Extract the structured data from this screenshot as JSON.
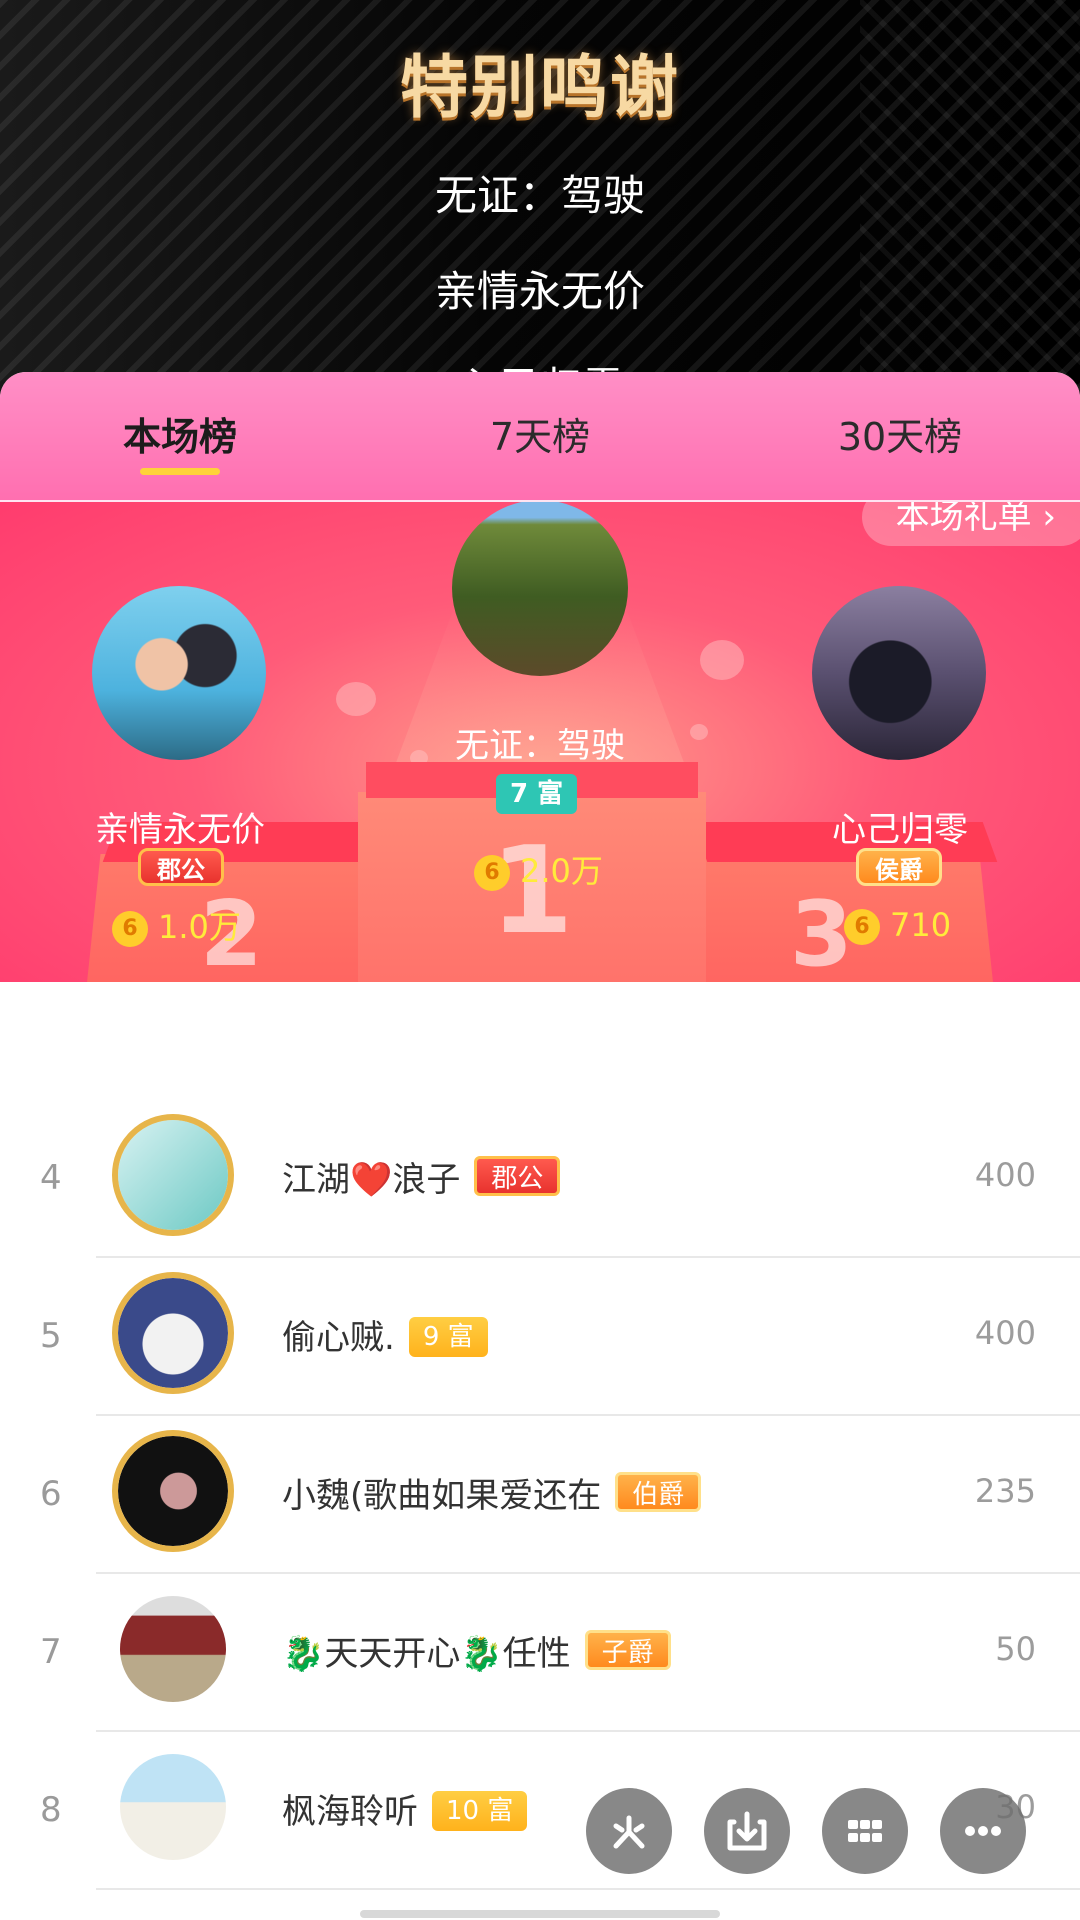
{
  "credits": {
    "title": "特别鸣谢",
    "lines": [
      "无证：驾驶",
      "亲情永无价",
      "心己归零"
    ]
  },
  "tabs": [
    {
      "label": "本场榜",
      "active": true
    },
    {
      "label": "7天榜",
      "active": false
    },
    {
      "label": "30天榜",
      "active": false
    }
  ],
  "gift_link": "本场礼单 ›",
  "podium": {
    "first": {
      "name": "无证：驾驶",
      "badge": "7 富",
      "score": "2.0万",
      "place": "1"
    },
    "second": {
      "name": "亲情永无价",
      "badge": "郡公",
      "score": "1.0万",
      "place": "2"
    },
    "third": {
      "name": "心己归零",
      "badge": "侯爵",
      "score": "710",
      "place": "3"
    }
  },
  "coin_symbol": "6",
  "list": [
    {
      "rank": "4",
      "name": "江湖❤️浪子",
      "tag": "郡公",
      "tag_style": "red",
      "score": "400"
    },
    {
      "rank": "5",
      "name": "偷心贼.",
      "tag": "9 富",
      "tag_style": "gold",
      "score": "400"
    },
    {
      "rank": "6",
      "name": "小魏(歌曲如果爱还在",
      "tag": "伯爵",
      "tag_style": "orange",
      "score": "235"
    },
    {
      "rank": "7",
      "name": "🐉天天开心🐉任性",
      "tag": "子爵",
      "tag_style": "orange",
      "score": "50"
    },
    {
      "rank": "8",
      "name": "枫海聆听",
      "tag": "10 富",
      "tag_style": "gold",
      "score": "30"
    }
  ],
  "fabs": [
    "share-icon",
    "download-icon",
    "grid-icon",
    "more-icon"
  ],
  "colors": {
    "accent": "#ff5b79",
    "tab_bg": "#ff7fb8",
    "underline": "#ffd23a",
    "wealth_badge": "#2ec6b4"
  }
}
